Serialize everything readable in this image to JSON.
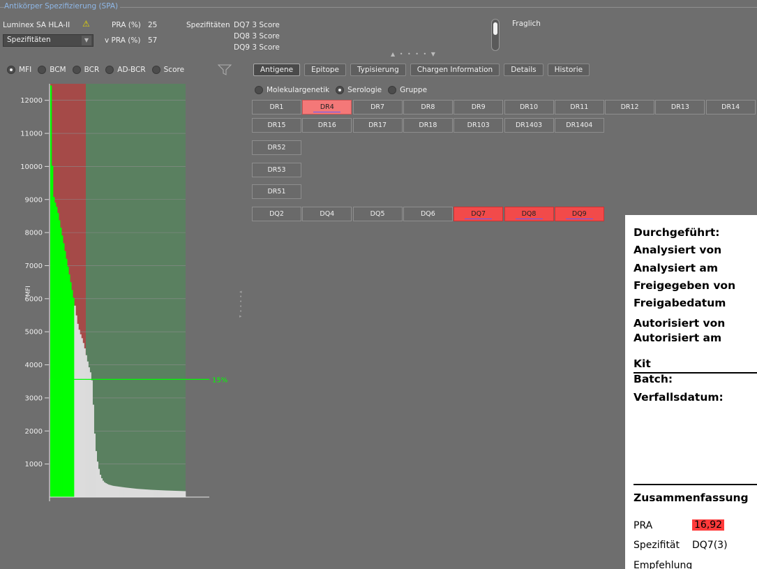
{
  "section": {
    "title": "Antikörper Spezifizierung (SPA)"
  },
  "header": {
    "assay": "Luminex SA HLA-II",
    "combo_value": "Spezifitäten",
    "pra_label": "PRA (%)",
    "pra_value": "25",
    "vpra_label": "v PRA (%)",
    "vpra_value": "57",
    "spec_label": "Spezifitäten",
    "spec_lines": [
      "DQ7 3 Score",
      "DQ8 3 Score",
      "DQ9 3 Score"
    ],
    "status": "Fraglich"
  },
  "score_modes": [
    {
      "label": "MFI",
      "selected": true
    },
    {
      "label": "BCM",
      "selected": false
    },
    {
      "label": "BCR",
      "selected": false
    },
    {
      "label": "AD-BCR",
      "selected": false
    },
    {
      "label": "Score",
      "selected": false
    }
  ],
  "tabs": [
    "Antigene",
    "Epitope",
    "Typisierung",
    "Chargen Information",
    "Details",
    "Historie"
  ],
  "active_tab": "Antigene",
  "antigen_modes": [
    {
      "label": "Molekulargenetik",
      "selected": false
    },
    {
      "label": "Serologie",
      "selected": true
    },
    {
      "label": "Gruppe",
      "selected": false
    }
  ],
  "antigen_rows": [
    [
      {
        "name": "DR1"
      },
      {
        "name": "DR4",
        "state": "light"
      },
      {
        "name": "DR7"
      },
      {
        "name": "DR8"
      },
      {
        "name": "DR9"
      },
      {
        "name": "DR10"
      },
      {
        "name": "DR11"
      },
      {
        "name": "DR12"
      },
      {
        "name": "DR13"
      },
      {
        "name": "DR14"
      }
    ],
    [
      {
        "name": "DR15"
      },
      {
        "name": "DR16"
      },
      {
        "name": "DR17"
      },
      {
        "name": "DR18"
      },
      {
        "name": "DR103"
      },
      {
        "name": "DR1403"
      },
      {
        "name": "DR1404"
      }
    ],
    [
      {
        "name": "DR52"
      }
    ],
    [
      {
        "name": "DR53"
      }
    ],
    [
      {
        "name": "DR51"
      }
    ],
    [
      {
        "name": "DQ2"
      },
      {
        "name": "DQ4"
      },
      {
        "name": "DQ5"
      },
      {
        "name": "DQ6"
      },
      {
        "name": "DQ7",
        "state": "strong"
      },
      {
        "name": "DQ8",
        "state": "strong"
      },
      {
        "name": "DQ9",
        "state": "strong"
      }
    ]
  ],
  "chart_data": {
    "type": "bar",
    "ylabel": "MFI",
    "y_ticks": [
      1000,
      2000,
      3000,
      4000,
      5000,
      6000,
      7000,
      8000,
      9000,
      10000,
      11000,
      12000
    ],
    "ylim": [
      0,
      12500
    ],
    "threshold": {
      "label": "15%",
      "value": 3560
    },
    "bead_count": 96,
    "positive_count": 17,
    "regions": {
      "positive_color": "#a54a48",
      "negative_color": "#5a8060"
    },
    "colors": {
      "positive_bar": "#00ff00",
      "negative_bar": "#dcdcdc",
      "threshold": "#00ff00"
    }
  },
  "report": {
    "lines": [
      "Durchgeführt:",
      "Analysiert von",
      "Analysiert am",
      "Freigegeben von",
      "Freigabedatum",
      "Autorisiert von",
      "Autorisiert am",
      "Kit",
      "Batch:",
      "Verfallsdatum:"
    ],
    "summary_title": "Zusammenfassung",
    "pra_key": "PRA",
    "pra_value": "16,92",
    "spec_key": "Spezifität",
    "spec_value": "DQ7(3)",
    "next_key": "Empfehlung"
  }
}
